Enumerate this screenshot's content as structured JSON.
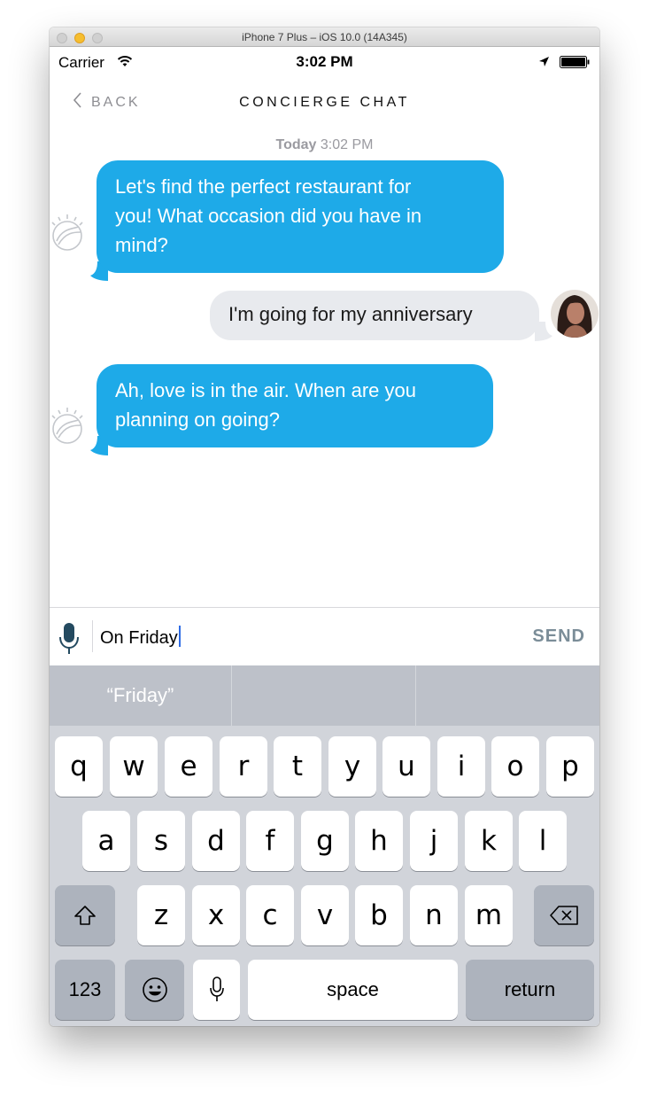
{
  "window": {
    "title": "iPhone 7 Plus – iOS 10.0 (14A345)"
  },
  "status_bar": {
    "carrier": "Carrier",
    "time": "3:02 PM"
  },
  "nav": {
    "back_label": "BACK",
    "title": "CONCIERGE CHAT"
  },
  "chat": {
    "date_day": "Today",
    "date_time": "3:02 PM",
    "messages": [
      {
        "sender": "bot",
        "text_lines": [
          "Let's find the perfect restaurant for",
          "you! What occasion did you have in",
          "mind?"
        ]
      },
      {
        "sender": "user",
        "text_lines": [
          "I'm going for my anniversary"
        ]
      },
      {
        "sender": "bot",
        "text_lines": [
          "Ah, love is in the air. When are you",
          "planning on going?"
        ]
      }
    ]
  },
  "input": {
    "value": "On Friday",
    "send_label": "SEND"
  },
  "keyboard": {
    "suggestions": [
      "“Friday”",
      "",
      ""
    ],
    "row1": [
      "q",
      "w",
      "e",
      "r",
      "t",
      "y",
      "u",
      "i",
      "o",
      "p"
    ],
    "row2": [
      "a",
      "s",
      "d",
      "f",
      "g",
      "h",
      "j",
      "k",
      "l"
    ],
    "row3": [
      "z",
      "x",
      "c",
      "v",
      "b",
      "n",
      "m"
    ],
    "numbers_label": "123",
    "space_label": "space",
    "return_label": "return"
  },
  "colors": {
    "bot_bubble": "#1eaae8",
    "user_bubble": "#e8eaee",
    "send": "#7b8d98",
    "caret": "#2f6ce5"
  }
}
